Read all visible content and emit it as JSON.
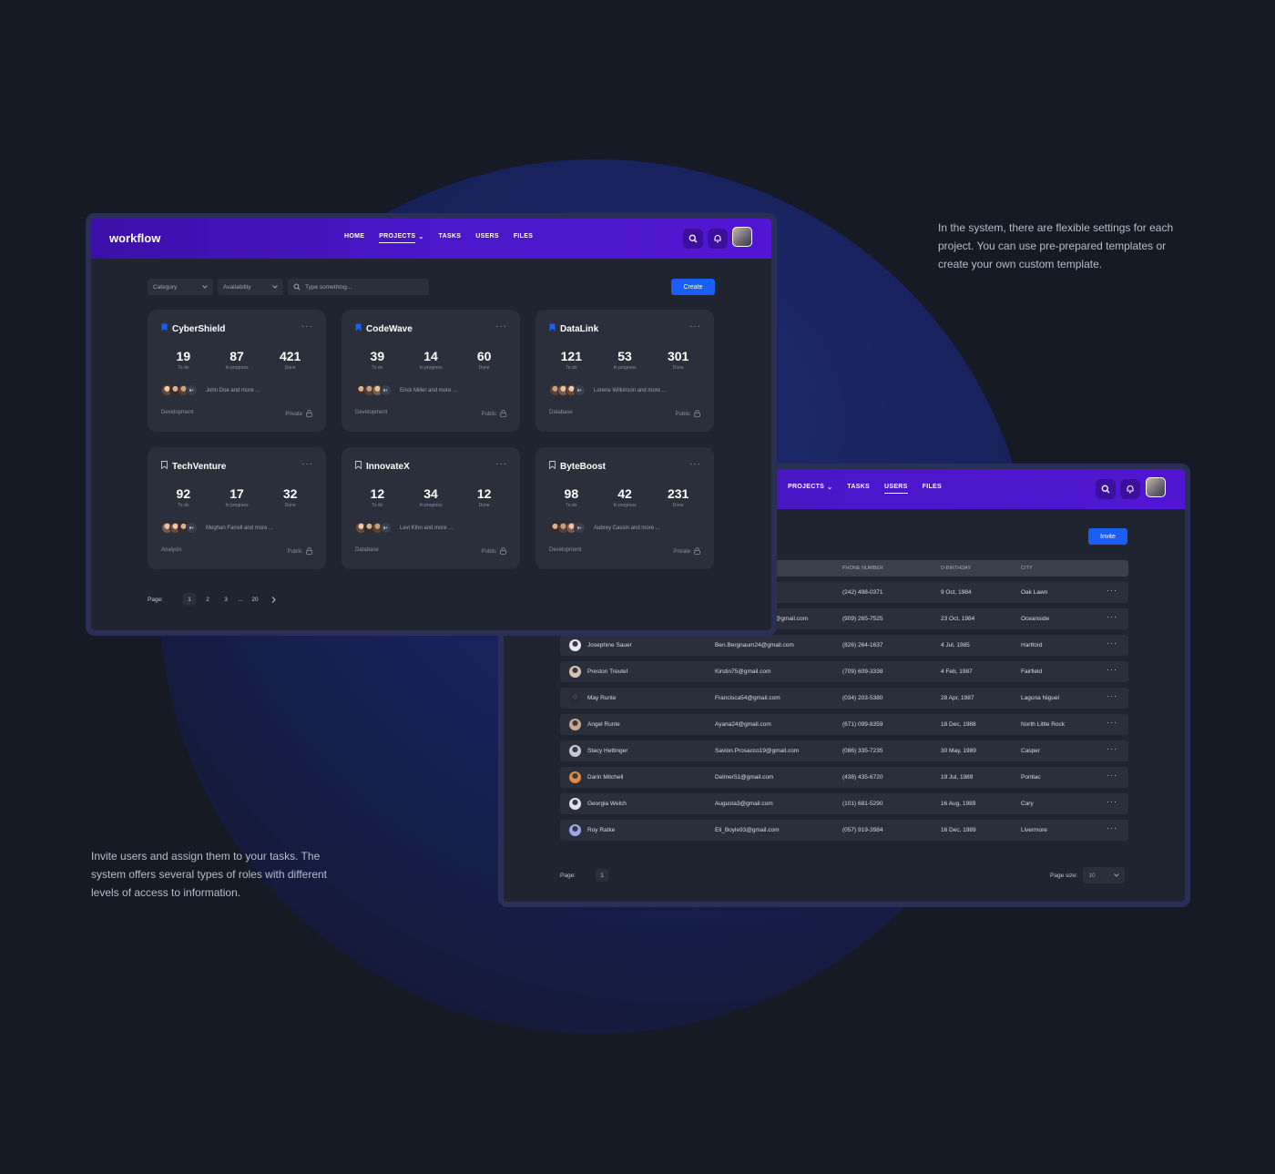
{
  "captions": {
    "right": "In the system, there are flexible settings for each project. You can use pre-prepared templates or create your own custom template.",
    "left": "Invite users and assign them to your tasks. The system offers several types of roles with different levels of access to information."
  },
  "colors": {
    "accent": "#1a5ef5",
    "topbar": "#4a17c9",
    "card": "#2b2e3b",
    "bg": "#161a24"
  },
  "projects_window": {
    "logo": "workflow",
    "nav": [
      "HOME",
      "PROJECTS",
      "TASKS",
      "USERS",
      "FILES"
    ],
    "active_nav": "PROJECTS",
    "filters": {
      "category": "Category",
      "availability": "Availability",
      "search_placeholder": "Type something..."
    },
    "create_label": "Create",
    "cards": [
      {
        "title": "CyberShield",
        "bookmarked": true,
        "todo": "19",
        "in_progress": "87",
        "done": "421",
        "people": "John Doe and more ...",
        "count": "8+",
        "category": "Development",
        "visibility": "Private"
      },
      {
        "title": "CodeWave",
        "bookmarked": true,
        "todo": "39",
        "in_progress": "14",
        "done": "60",
        "people": "Erick Miller and more ...",
        "count": "8+",
        "category": "Development",
        "visibility": "Public"
      },
      {
        "title": "DataLink",
        "bookmarked": true,
        "todo": "121",
        "in_progress": "53",
        "done": "301",
        "people": "Lorene Wilkinson and more ...",
        "count": "8+",
        "category": "Database",
        "visibility": "Public"
      },
      {
        "title": "TechVenture",
        "bookmarked": false,
        "todo": "92",
        "in_progress": "17",
        "done": "32",
        "people": "Meghan Farrell and more ...",
        "count": "8+",
        "category": "Analysis",
        "visibility": "Public"
      },
      {
        "title": "InnovateX",
        "bookmarked": false,
        "todo": "12",
        "in_progress": "34",
        "done": "12",
        "people": "Levi Kihn and more ...",
        "count": "8+",
        "category": "Database",
        "visibility": "Public"
      },
      {
        "title": "ByteBoost",
        "bookmarked": false,
        "todo": "98",
        "in_progress": "42",
        "done": "231",
        "people": "Aubrey Cassin and more ...",
        "count": "8+",
        "category": "Development",
        "visibility": "Private"
      }
    ],
    "stat_labels": {
      "todo": "To do",
      "in_progress": "In progress",
      "done": "Done"
    },
    "pagination": {
      "label": "Page:",
      "pages": [
        "1",
        "2",
        "3",
        "...",
        "20"
      ],
      "current": "1"
    }
  },
  "users_window": {
    "nav": [
      "E",
      "PROJECTS",
      "TASKS",
      "USERS",
      "FILES"
    ],
    "active_nav": "USERS",
    "invite_label": "Invite",
    "columns": [
      "PHONE NUMBER",
      "D-BIRTHDAY",
      "CITY"
    ],
    "rows": [
      {
        "name": "",
        "email": "n",
        "phone": "(242) 498-0371",
        "birthday": "9 Oct, 1984",
        "city": "Oak Lawn"
      },
      {
        "name": "",
        "email": "@gmail.com",
        "phone": "(909) 265-7525",
        "birthday": "23 Oct, 1984",
        "city": "Oceanside"
      },
      {
        "name": "Josephine Sauer",
        "email": "Ben.Bergnaum24@gmail.com",
        "phone": "(826) 264-1637",
        "birthday": "4 Jul, 1985",
        "city": "Hartford"
      },
      {
        "name": "Preston Treutel",
        "email": "Kirstin75@gmail.com",
        "phone": "(709) 609-3338",
        "birthday": "4 Feb, 1987",
        "city": "Fairfield"
      },
      {
        "name": "May Runte",
        "email": "Francisca54@gmail.com",
        "phone": "(034) 203-5380",
        "birthday": "28 Apr, 1987",
        "city": "Laguna Niguel"
      },
      {
        "name": "Angel Runte",
        "email": "Ayana24@gmail.com",
        "phone": "(671) 099-8359",
        "birthday": "18 Dec, 1988",
        "city": "North Little Rock"
      },
      {
        "name": "Stacy Hettinger",
        "email": "Savion.Prosacco19@gmail.com",
        "phone": "(086) 335-7235",
        "birthday": "30 May, 1989",
        "city": "Casper"
      },
      {
        "name": "Darin Mitchell",
        "email": "Delmer51@gmail.com",
        "phone": "(438) 435-6720",
        "birthday": "19 Jul, 1989",
        "city": "Pontiac"
      },
      {
        "name": "Georgia Welch",
        "email": "Augusta3@gmail.com",
        "phone": "(101) 681-5290",
        "birthday": "16 Aug, 1989",
        "city": "Cary"
      },
      {
        "name": "Roy Ratke",
        "email": "Eli_Boyle93@gmail.com",
        "phone": "(057) 919-3984",
        "birthday": "16 Dec, 1989",
        "city": "Livermore"
      }
    ],
    "pagination": {
      "label": "Page:",
      "current": "1",
      "size_label": "Page size:",
      "size_value": "10"
    }
  }
}
